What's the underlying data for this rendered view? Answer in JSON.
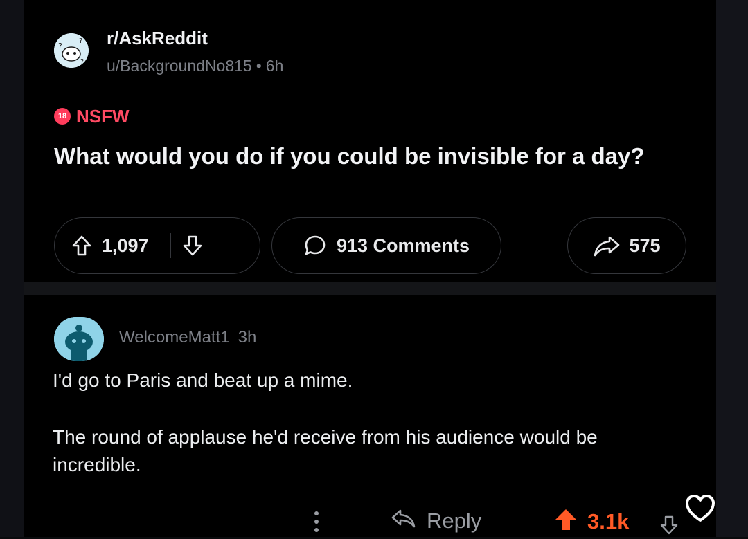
{
  "post": {
    "subreddit": "r/AskReddit",
    "author": "u/BackgroundNo815",
    "age": "6h",
    "nsfw_badge": "18",
    "nsfw_label": "NSFW",
    "title": "What would you do if you could be invisible for a day?",
    "upvotes": "1,097",
    "comments": "913 Comments",
    "shares": "575"
  },
  "comment": {
    "author": "WelcomeMatt1",
    "age": "3h",
    "paragraphs": [
      "I'd go to Paris and beat up a mime.",
      "The round of applause he'd receive from his audience would be incredible."
    ],
    "reply_label": "Reply",
    "score": "3.1k"
  },
  "colors": {
    "background": "#000000",
    "nsfw": "#ff4a63",
    "upvote_active": "#ff5a26",
    "muted_text": "#7c7f86"
  },
  "icons": [
    "subreddit-avatar",
    "upvote-icon",
    "downvote-icon",
    "comment-icon",
    "share-icon",
    "user-avatar",
    "more-icon",
    "reply-icon",
    "heart-icon"
  ]
}
